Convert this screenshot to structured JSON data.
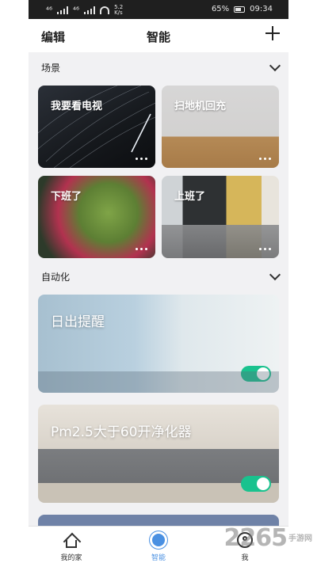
{
  "status_bar": {
    "signal_left": "⁴⁶",
    "signal_right": "⁴⁶",
    "speed_value": "5.2",
    "speed_unit": "K/s",
    "battery": "65%",
    "time": "09:34"
  },
  "header": {
    "edit_label": "编辑",
    "title": "智能",
    "add_icon": "plus-icon"
  },
  "scenes": {
    "section_label": "场景",
    "items": [
      {
        "name": "我要看电视"
      },
      {
        "name": "扫地机回充"
      },
      {
        "name": "下班了"
      },
      {
        "name": "上班了"
      }
    ]
  },
  "automation": {
    "section_label": "自动化",
    "items": [
      {
        "name": "日出提醒",
        "enabled": true
      },
      {
        "name": "Pm2.5大于60开净化器",
        "enabled": true
      }
    ]
  },
  "tabs": [
    {
      "label": "我的家",
      "icon": "home-icon",
      "active": false
    },
    {
      "label": "智能",
      "icon": "sun-icon",
      "active": true
    },
    {
      "label": "我",
      "icon": "profile-icon",
      "active": false
    }
  ],
  "watermark": {
    "text": "2265",
    "sub": "手游网"
  },
  "colors": {
    "accent": "#4a90e2",
    "toggle_on": "#19c28e"
  }
}
